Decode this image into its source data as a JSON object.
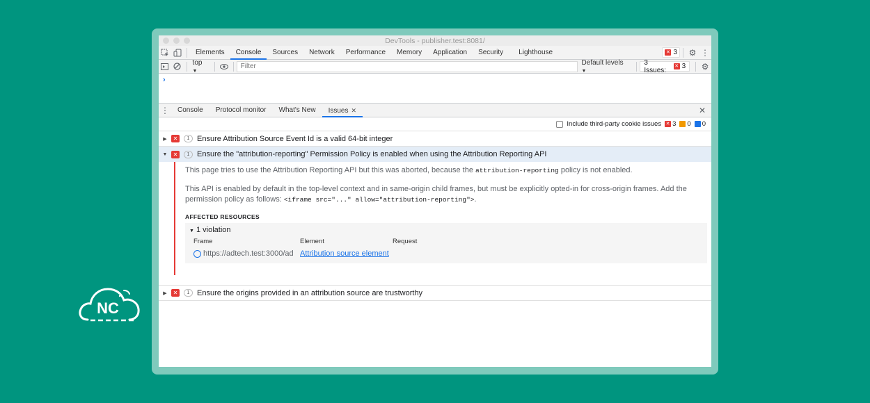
{
  "window": {
    "title": "DevTools - publisher.test:8081/"
  },
  "toolbar": {
    "tabs": [
      "Elements",
      "Console",
      "Sources",
      "Network",
      "Performance",
      "Memory",
      "Application",
      "Security",
      "Lighthouse"
    ],
    "active_tab": "Console",
    "error_count": "3"
  },
  "filterbar": {
    "context": "top",
    "filter_placeholder": "Filter",
    "levels": "Default levels",
    "issues_label": "3 Issues:",
    "issues_count": "3"
  },
  "console": {
    "prompt": "›"
  },
  "drawer": {
    "tabs": [
      "Console",
      "Protocol monitor",
      "What's New",
      "Issues"
    ],
    "active_tab": "Issues"
  },
  "issues_toolbar": {
    "checkbox_label": "Include third-party cookie issues",
    "error_count": "3",
    "warning_count": "0",
    "info_count": "0"
  },
  "issues": [
    {
      "title": "Ensure Attribution Source Event Id is a valid 64-bit integer",
      "count": "1"
    },
    {
      "title": "Ensure the \"attribution-reporting\" Permission Policy is enabled when using the Attribution Reporting API",
      "count": "1"
    },
    {
      "title": "Ensure the origins provided in an attribution source are trustworthy",
      "count": "1"
    }
  ],
  "expanded": {
    "p1_pre": "This page tries to use the Attribution Reporting API but this was aborted, because the ",
    "p1_code": "attribution-reporting",
    "p1_post": " policy is not enabled.",
    "p2_pre": "This API is enabled by default in the top-level context and in same-origin child frames, but must be explicitly opted-in for cross-origin frames. Add the permission policy as follows: ",
    "p2_code": "<iframe src=\"...\" allow=\"attribution-reporting\">",
    "p2_post": ".",
    "affected_heading": "AFFECTED RESOURCES",
    "violation_label": "1 violation",
    "columns": [
      "Frame",
      "Element",
      "Request"
    ],
    "frame_url": "https://adtech.test:3000/ad",
    "element_link": "Attribution source element"
  },
  "logo": {
    "text": "NC"
  },
  "colors": {
    "background": "#00957f",
    "accent": "#1a73e8",
    "error": "#e53935",
    "warning": "#f29900"
  }
}
